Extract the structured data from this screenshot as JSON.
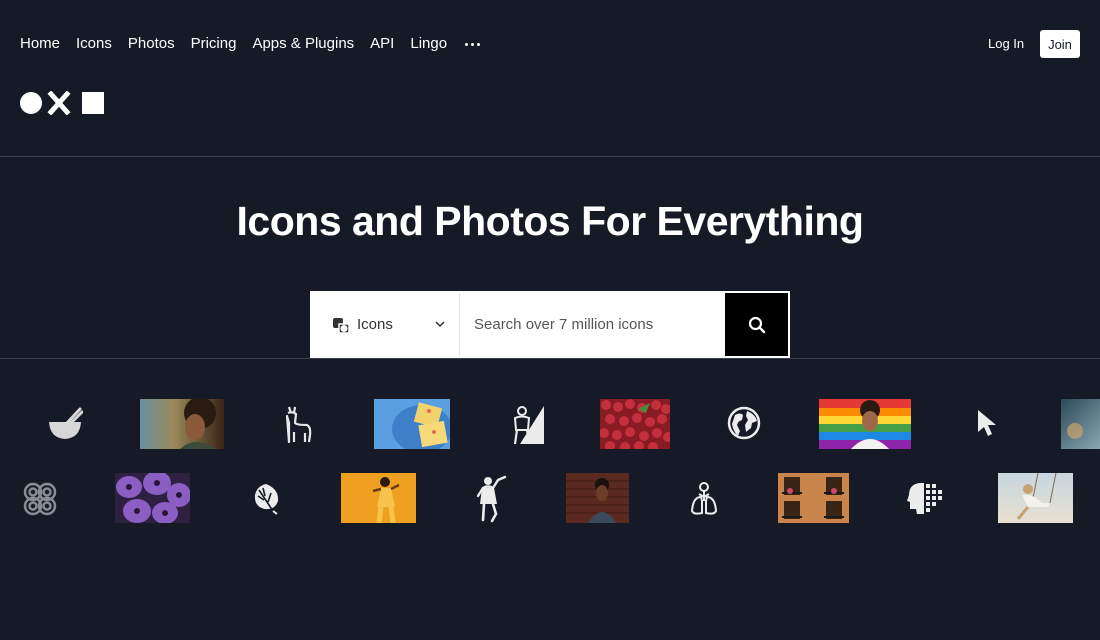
{
  "nav": {
    "links": [
      "Home",
      "Icons",
      "Photos",
      "Pricing",
      "Apps & Plugins",
      "API",
      "Lingo"
    ],
    "more_icon": "more-horizontal-icon",
    "login_label": "Log In",
    "join_label": "Join"
  },
  "logo": {
    "shapes": [
      "circle",
      "x",
      "square"
    ]
  },
  "hero": {
    "title": "Icons and Photos For Everything"
  },
  "search": {
    "type_label": "Icons",
    "type_icon": "shapes-icon",
    "placeholder": "Search over 7 million icons",
    "button_icon": "search-icon"
  },
  "gallery": {
    "row1": [
      "bowl-chopsticks-icon",
      "photo-woman-curly-hair",
      "llama-icon",
      "photo-blue-snack",
      "hero-figure-icon",
      "photo-red-berries",
      "globe-icon",
      "photo-man-rainbow",
      "cursor-icon",
      "photo-partial"
    ],
    "row2": [
      "spiral-pattern-icon",
      "photo-purple-flowers",
      "leaf-icon",
      "photo-yellow-dancer",
      "dancer-icon",
      "photo-man-brick-wall",
      "lungs-icon",
      "photo-building-balcony",
      "pixel-head-icon",
      "photo-woman-swing"
    ]
  },
  "colors": {
    "background": "#161a26",
    "divider": "#3a3e4b",
    "button": "#000000"
  }
}
